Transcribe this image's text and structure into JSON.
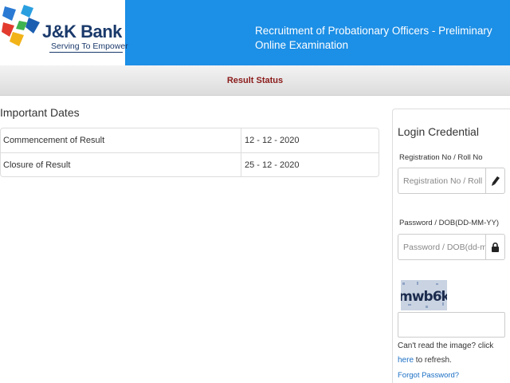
{
  "header": {
    "brand_name": "J&K Bank",
    "tagline": "Serving To Empower",
    "title": "Recruitment of Probationary Officers - Preliminary Online Examination",
    "background_color": "#1c8fe6"
  },
  "status_bar": {
    "title": "Result Status",
    "title_color": "#8b1a1a"
  },
  "important_dates": {
    "heading": "Important Dates",
    "rows": [
      {
        "label": "Commencement of Result",
        "value": "12 - 12 - 2020"
      },
      {
        "label": "Closure of Result",
        "value": "25 - 12 - 2020"
      }
    ]
  },
  "login": {
    "title": "Login Credential",
    "registration_label": "Registration No / Roll No",
    "registration_placeholder": "Registration No / Roll No",
    "registration_value": "",
    "registration_icon": "pencil-icon",
    "password_label": "Password / DOB(DD-MM-YY)",
    "password_placeholder": "Password / DOB(dd-mm-yy)",
    "password_value": "",
    "password_icon": "lock-icon",
    "captcha_text": "mwb6k",
    "captcha_input_value": "",
    "refresh_prefix": "Can't read the image? click",
    "refresh_link": "here",
    "refresh_suffix": "to refresh.",
    "forgot_password": "Forgot Password?",
    "link_color": "#1a6fc4"
  }
}
